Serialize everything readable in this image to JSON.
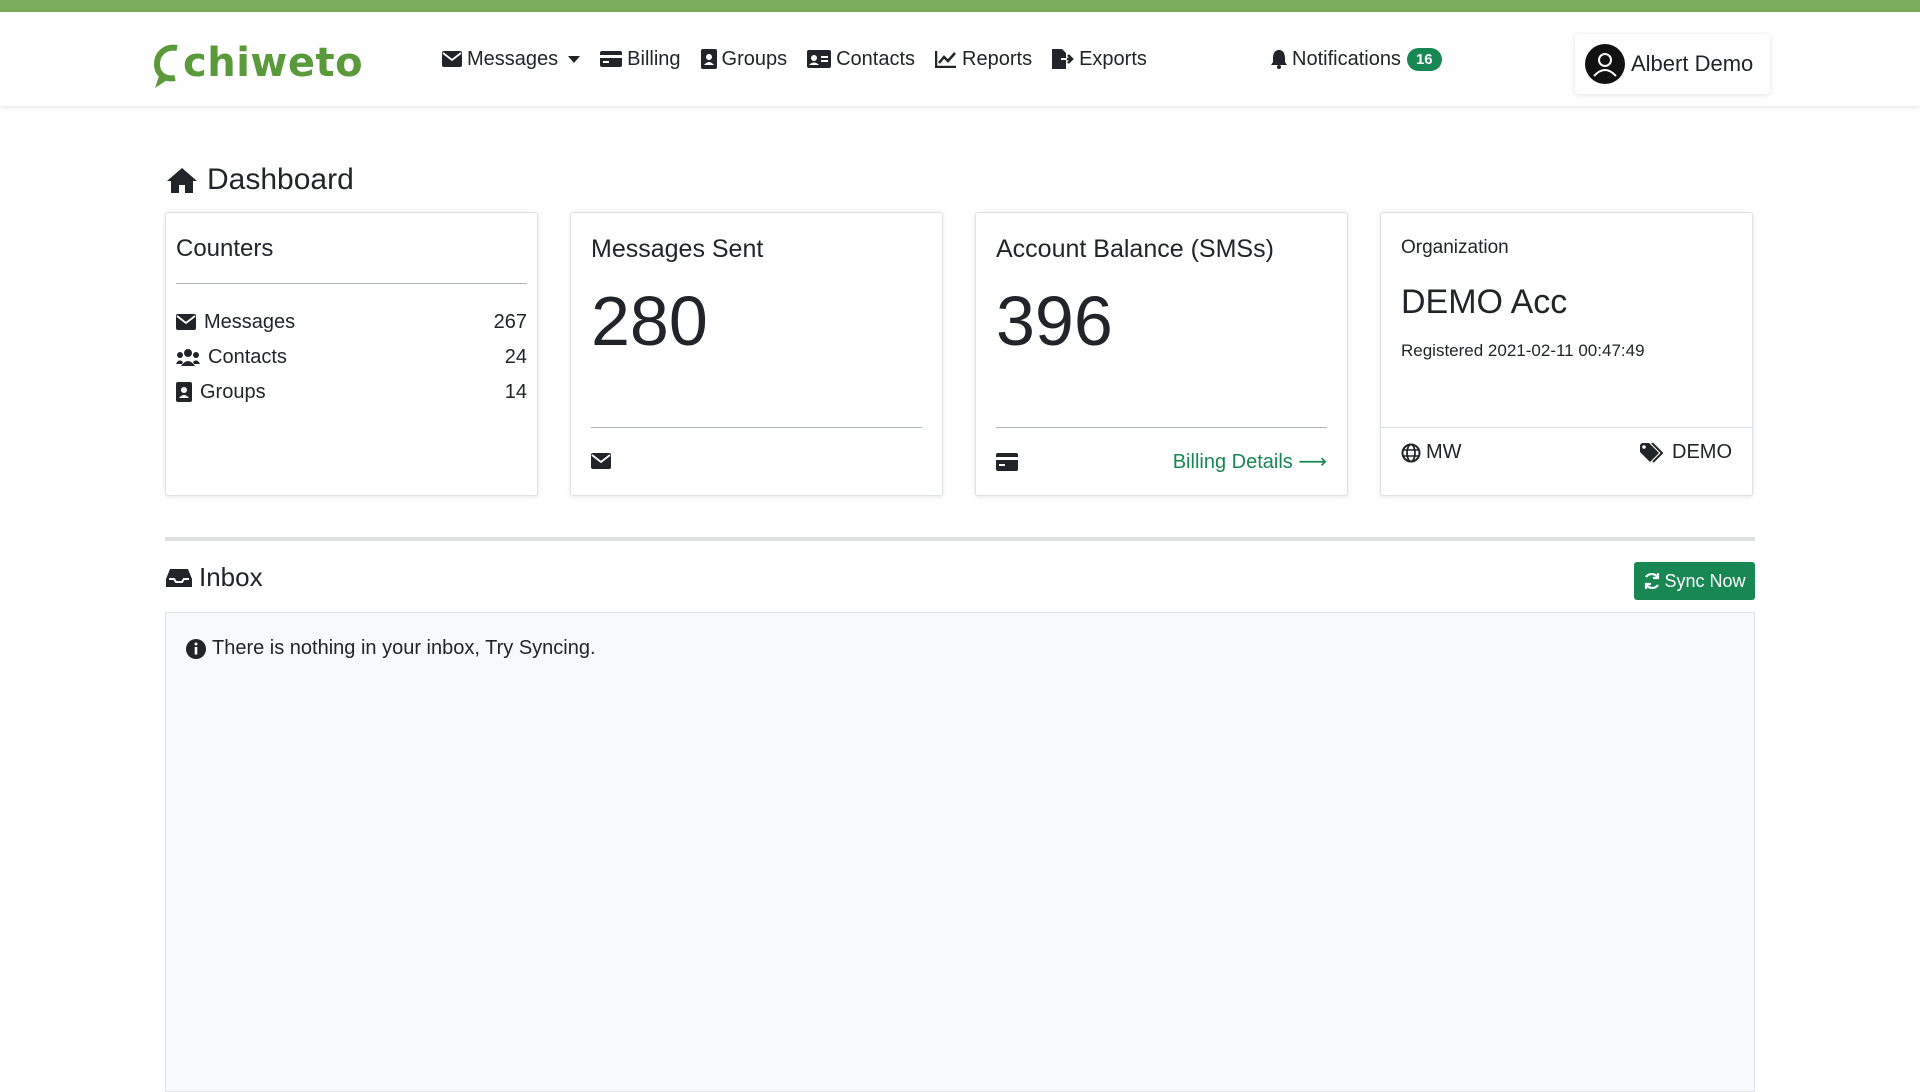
{
  "brand": {
    "logo_text": "chiweto",
    "accent_color": "#7aaa5c",
    "primary_color": "#198754"
  },
  "nav": {
    "items": [
      {
        "label": "Messages",
        "icon": "envelope-icon"
      },
      {
        "label": "Billing",
        "icon": "credit-card-icon"
      },
      {
        "label": "Groups",
        "icon": "address-book-icon"
      },
      {
        "label": "Contacts",
        "icon": "id-card-icon"
      },
      {
        "label": "Reports",
        "icon": "line-chart-icon"
      },
      {
        "label": "Exports",
        "icon": "file-export-icon"
      }
    ],
    "notifications_label": "Notifications",
    "notifications_count": "16",
    "user_name": "Albert Demo"
  },
  "page": {
    "title": "Dashboard"
  },
  "counters": {
    "title": "Counters",
    "rows": [
      {
        "label": "Messages",
        "value": "267",
        "icon": "envelope-icon"
      },
      {
        "label": "Contacts",
        "value": "24",
        "icon": "users-icon"
      },
      {
        "label": "Groups",
        "value": "14",
        "icon": "address-book-icon"
      }
    ]
  },
  "messages_sent": {
    "title": "Messages Sent",
    "value": "280"
  },
  "balance": {
    "title": "Account Balance (SMSs)",
    "value": "396",
    "link": "Billing Details ⟶"
  },
  "organization": {
    "label": "Organization",
    "name": "DEMO Acc",
    "registered": "Registered 2021-02-11 00:47:49",
    "country": "MW",
    "tag": "DEMO"
  },
  "inbox": {
    "title": "Inbox",
    "sync_label": "Sync Now",
    "empty_message": "There is nothing in your inbox, Try Syncing."
  }
}
